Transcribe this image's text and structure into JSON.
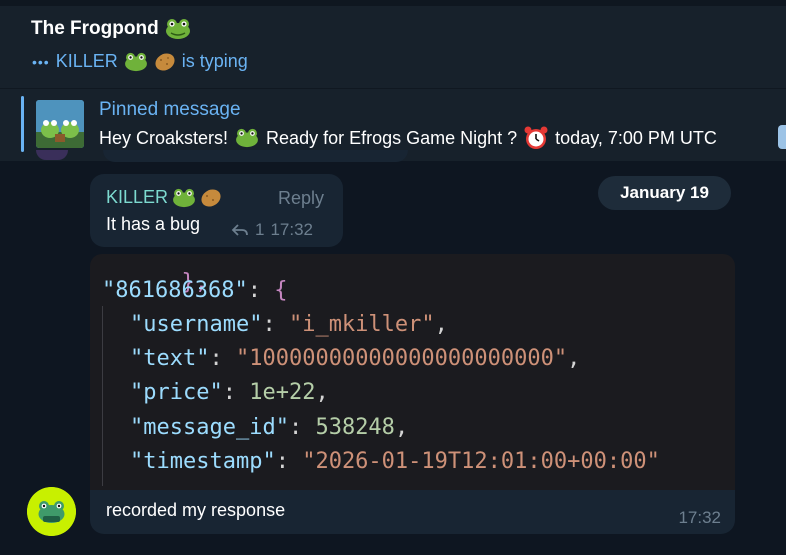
{
  "header": {
    "title": "The Frogpond",
    "title_icon": "frog-emoji",
    "typing": {
      "dots": "•••",
      "user": "KILLER",
      "suffix": "is typing"
    }
  },
  "pinned": {
    "label": "Pinned message",
    "text_before": "Hey Croaksters!",
    "text_mid": "Ready for Efrogs Game Night ?",
    "text_after": "today, 7:00 PM UTC"
  },
  "date_separator": "January 19",
  "reply_message": {
    "sender": "KILLER",
    "reply_label": "Reply",
    "text": "It has a bug",
    "reply_count": "1",
    "time": "17:32"
  },
  "code": {
    "lines": [
      "},",
      "\"861686368\": {",
      "\"username\": \"i_mkiller\",",
      "\"text\": \"10000000000000000000000\",",
      "\"price\": 1e+22,",
      "\"message_id\": 538248,",
      "\"timestamp\": \"2026-01-19T12:01:00+00:00\""
    ],
    "id_key": "\"861686368\"",
    "username_key": "\"username\"",
    "username_val": "\"i_mkiller\"",
    "text_key": "\"text\"",
    "text_val": "\"10000000000000000000000\"",
    "price_key": "\"price\"",
    "price_val": "1e+22",
    "msgid_key": "\"message_id\"",
    "msgid_val": "538248",
    "ts_key": "\"timestamp\"",
    "ts_val": "\"2026-01-19T12:01:00+00:00\""
  },
  "final_message": {
    "text": "recorded my response",
    "time": "17:32"
  },
  "colors": {
    "background": "#0e1621",
    "header": "#17212b",
    "bubble": "#182533",
    "accent": "#6ab3f3",
    "name_color": "#7ddad0"
  }
}
